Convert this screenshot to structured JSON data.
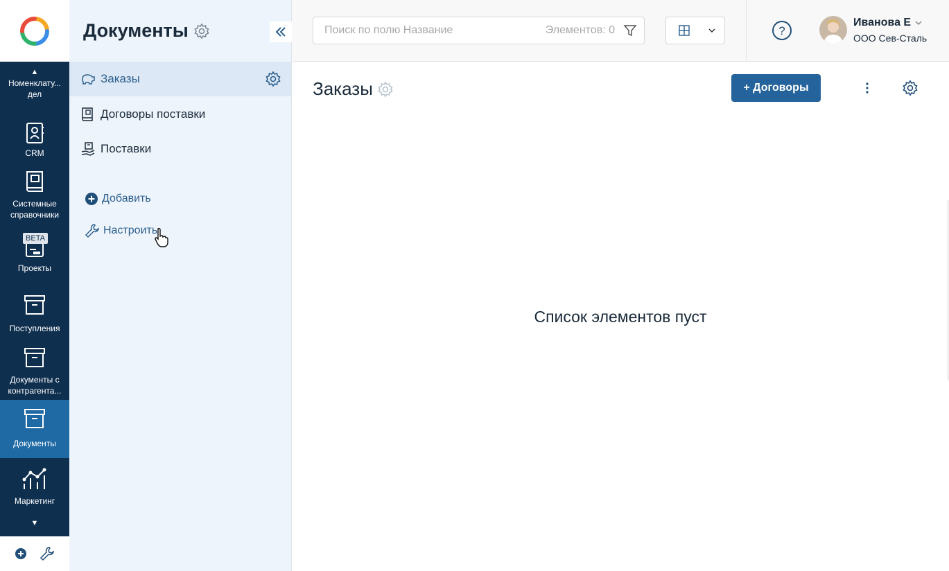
{
  "rail": {
    "items": [
      {
        "label": "Номенклату... дел",
        "icon": "folder-icon"
      },
      {
        "label": "CRM",
        "icon": "contact-book-icon"
      },
      {
        "label": "Системные справочники",
        "icon": "book-icon"
      },
      {
        "label": "Проекты",
        "icon": "project-icon",
        "badge": "BETA"
      },
      {
        "label": "Поступления",
        "icon": "archive-box-icon"
      },
      {
        "label": "Документы с контрагента...",
        "icon": "archive-box-icon"
      },
      {
        "label": "Документы",
        "icon": "archive-box-icon",
        "active": true
      },
      {
        "label": "Маркетинг",
        "icon": "chart-icon"
      }
    ]
  },
  "sidebar": {
    "title": "Документы",
    "items": [
      {
        "label": "Заказы",
        "icon": "piggy-bank-icon",
        "active": true
      },
      {
        "label": "Договоры поставки",
        "icon": "document-icon"
      },
      {
        "label": "Поставки",
        "icon": "delivery-icon"
      }
    ],
    "add_label": "Добавить",
    "configure_label": "Настроить"
  },
  "header": {
    "search_placeholder": "Поиск по полю Название",
    "items_count": "Элементов: 0",
    "user_name": "Иванова Е",
    "user_org": "ООО Сев-Сталь"
  },
  "main": {
    "title": "Заказы",
    "add_button": "+ Договоры",
    "empty_message": "Список элементов пуст"
  },
  "colors": {
    "rail_bg": "#0f2f4f",
    "rail_active": "#1f6aa5",
    "sidebar_bg": "#eef4fb",
    "accent": "#24639b"
  }
}
